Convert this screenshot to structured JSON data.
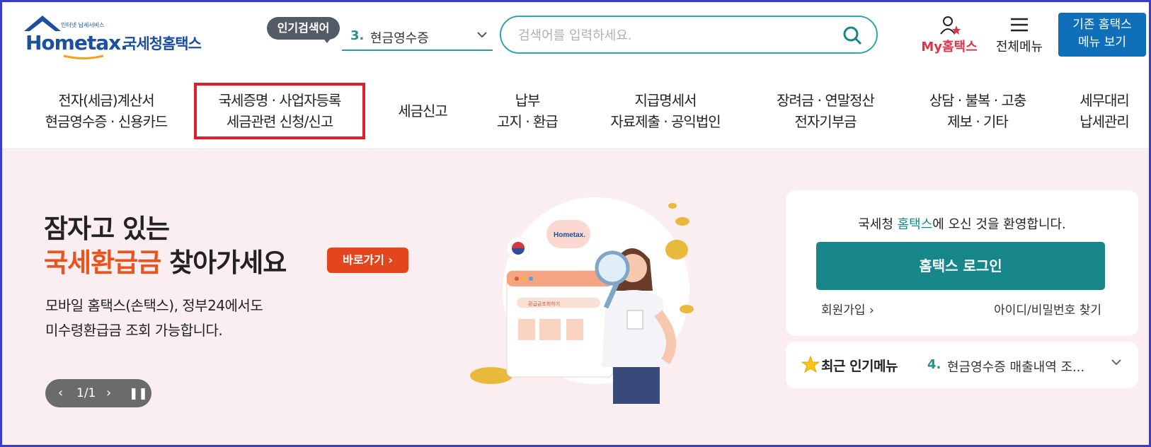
{
  "header": {
    "logo_tagline": "인터넷 납세서비스",
    "logo_word": "Hometax.",
    "logo_korean": "국세청홈택스",
    "popular_badge": "인기검색어",
    "popular_rank": "3.",
    "popular_term": "현금영수증",
    "search_placeholder": "검색어를 입력하세요.",
    "my_label": "My홈택스",
    "all_menu_label": "전체메뉴",
    "old_menu_line1": "기존 홈택스",
    "old_menu_line2": "메뉴 보기"
  },
  "nav": {
    "items": [
      {
        "line1": "전자(세금)계산서",
        "line2": "현금영수증 · 신용카드"
      },
      {
        "line1": "국세증명 · 사업자등록",
        "line2": "세금관련 신청/신고"
      },
      {
        "line1": "세금신고",
        "line2": ""
      },
      {
        "line1": "납부",
        "line2": "고지 · 환급"
      },
      {
        "line1": "지급명세서",
        "line2": "자료제출 · 공익법인"
      },
      {
        "line1": "장려금 · 연말정산",
        "line2": "전자기부금"
      },
      {
        "line1": "상담 · 불복 · 고충",
        "line2": "제보 · 기타"
      },
      {
        "line1": "세무대리",
        "line2": "납세관리"
      }
    ]
  },
  "hero": {
    "headline_line1": "잠자고 있는",
    "headline_accent": "국세환급금",
    "headline_rest": " 찾아가세요",
    "go_button": "바로가기 ›",
    "sub_line1": "모바일 홈택스(손택스), 정부24에서도",
    "sub_line2": "미수령환급금 조회 가능합니다.",
    "pager_prev": "‹",
    "pager_count": "1/1",
    "pager_next": "›",
    "pager_pause": "❚❚",
    "illus_logo": "Hometax.",
    "illus_window_title": "환급금조회하기"
  },
  "login": {
    "welcome_prefix": "국세청 ",
    "welcome_brand": "홈택스",
    "welcome_suffix": "에 오신 것을 환영합니다.",
    "login_button": "홈택스 로그인",
    "signup": "회원가입 ›",
    "find": "아이디/비밀번호 찾기"
  },
  "popular_menu": {
    "title": "최근 인기메뉴",
    "rank": "4.",
    "item": "현금영수증 매출내역 조...",
    "chevron": "⌄"
  },
  "colors": {
    "brand_blue": "#1b4fa0",
    "teal": "#16868a",
    "accent_orange": "#e8541e",
    "highlight_red": "#e01e2b",
    "hero_bg": "#fbeef0"
  }
}
